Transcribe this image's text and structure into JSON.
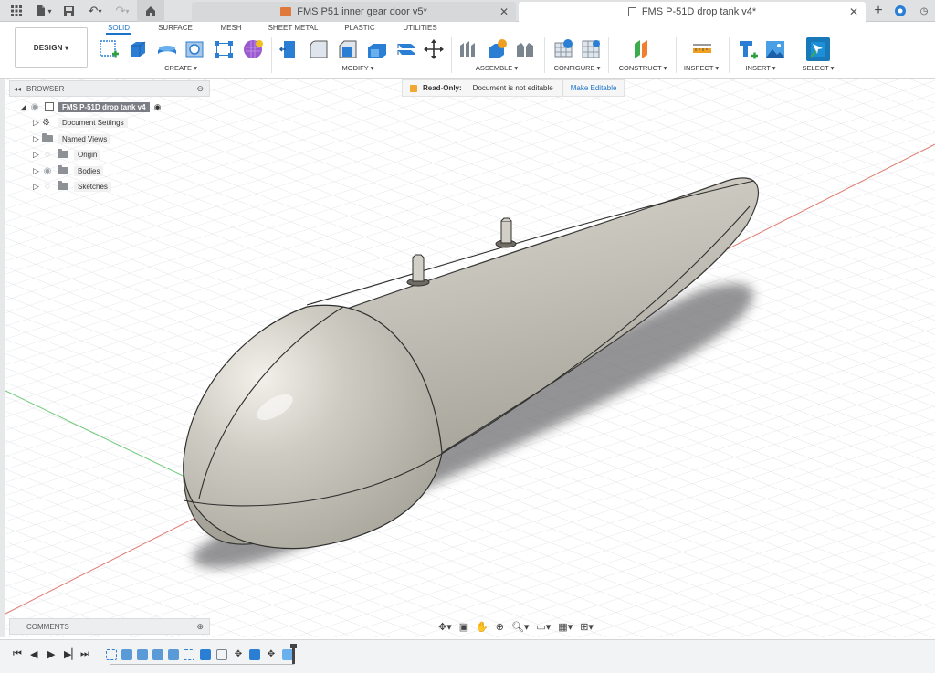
{
  "tabs": [
    {
      "label": "FMS P51 inner gear door v5*",
      "active": false
    },
    {
      "label": "FMS P-51D drop tank v4*",
      "active": true
    }
  ],
  "ribbon": {
    "workspace": "DESIGN ▾",
    "tabs": [
      "SOLID",
      "SURFACE",
      "MESH",
      "SHEET METAL",
      "PLASTIC",
      "UTILITIES"
    ],
    "groups": [
      "CREATE ▾",
      "MODIFY ▾",
      "ASSEMBLE ▾",
      "CONFIGURE ▾",
      "CONSTRUCT ▾",
      "INSPECT ▾",
      "INSERT ▾",
      "SELECT ▾"
    ]
  },
  "browser": {
    "title": "BROWSER",
    "root": "FMS P-51D drop tank v4",
    "items": [
      "Document Settings",
      "Named Views",
      "Origin",
      "Bodies",
      "Sketches"
    ]
  },
  "banner": {
    "label": "Read-Only:",
    "message": "Document is not editable",
    "action": "Make Editable"
  },
  "comments": {
    "title": "COMMENTS"
  },
  "colors": {
    "accent": "#1a73c9",
    "body": "#c2c0b8",
    "axis_red": "#e07a70",
    "axis_green": "#6ec97a"
  },
  "icons": [
    "grid-menu-icon",
    "file-icon",
    "save-icon",
    "undo-icon",
    "redo-icon",
    "home-icon",
    "add-tab-icon",
    "help-icon"
  ]
}
